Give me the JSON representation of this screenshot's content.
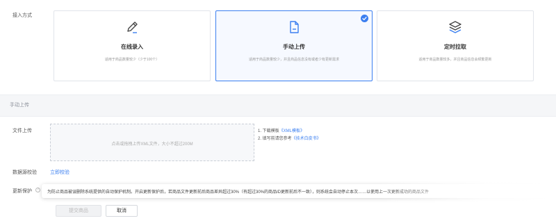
{
  "entry_method": {
    "label": "接入方式",
    "options": [
      {
        "title": "在线录入",
        "desc": "适用于商品数量较少（少于100个）",
        "icon": "pencil-icon",
        "selected": false
      },
      {
        "title": "手动上传",
        "desc": "适用于商品数量较少，并且商品信息没有或者少有更新需求",
        "icon": "document-icon",
        "selected": true
      },
      {
        "title": "定时拉取",
        "desc": "适用于商品数量较多，并且商品信息会频繁更新",
        "icon": "layers-icon",
        "selected": false
      }
    ]
  },
  "manual_upload": {
    "section_title": "手动上传",
    "file_upload_label": "文件上传",
    "dropzone_hint": "点击或拖拽上传XML文件，大小不超过200M",
    "tips": {
      "step1_prefix": "1. 下载模板",
      "step1_link": "《XML模板》",
      "step2_prefix": "2. 填写前请您参考",
      "step2_link": "《技术白皮书》"
    },
    "data_source_check_label": "数据源校验",
    "data_source_check_link": "立即校验",
    "update_protection_label": "更新保护",
    "tooltip_text": "为防止商品被误删除系统提供的自动保护机制。开启更新保护后，若商品文件更新前后商品差异超过30%（有超过30%的商品ID更新前后不一致），则系统会自动停止本次……以使用上一次更新成功的商品文件"
  },
  "actions": {
    "submit_label": "提交商品",
    "cancel_label": "取消"
  },
  "colors": {
    "accent": "#3b7ff0",
    "active_bg": "#f6f9ff"
  }
}
